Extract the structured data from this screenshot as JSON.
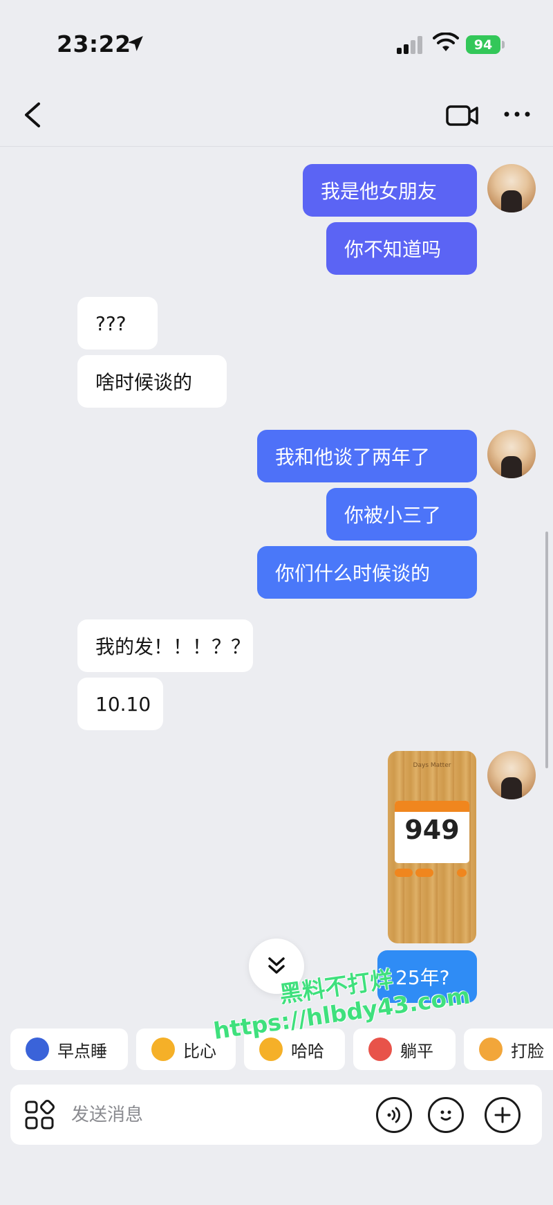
{
  "status_bar": {
    "time": "23:22",
    "battery": "94",
    "icons": [
      "location-arrow-icon",
      "signal-icon",
      "wifi-icon",
      "battery-icon"
    ]
  },
  "nav": {
    "icons": [
      "back-arrow-icon",
      "video-camera-icon",
      "more-dots-icon"
    ]
  },
  "messages": [
    {
      "side": "out",
      "text": "我是他女朋友",
      "color": "#5b64f4"
    },
    {
      "side": "out",
      "text": "你不知道吗",
      "color": "#5b64f4"
    },
    {
      "side": "in",
      "text": "???"
    },
    {
      "side": "in",
      "text": "啥时候谈的"
    },
    {
      "side": "out",
      "text": "我和他谈了两年了",
      "color": "#4e71f8"
    },
    {
      "side": "out",
      "text": "你被小三了",
      "color": "#4c74f9"
    },
    {
      "side": "out",
      "text": "你们什么时候谈的",
      "color": "#4a78f9"
    },
    {
      "side": "in",
      "text": "我的发！！！？？"
    },
    {
      "side": "in",
      "text": "10.10"
    },
    {
      "side": "out",
      "type": "image",
      "image": {
        "title": "Days Matter",
        "number": "949"
      }
    },
    {
      "side": "out",
      "text": "25年?",
      "color": "#2f8cf5"
    }
  ],
  "quick_replies": [
    {
      "label": "早点睡",
      "emoji_color": "#3a63d9"
    },
    {
      "label": "比心",
      "emoji_color": "#f5b028"
    },
    {
      "label": "哈哈",
      "emoji_color": "#f5b028"
    },
    {
      "label": "躺平",
      "emoji_color": "#e8534a"
    },
    {
      "label": "打脸",
      "emoji_color": "#f2a63a"
    }
  ],
  "watermark": {
    "line1": "黑料不打烊",
    "line2": "https://hlbdy43.com"
  },
  "input": {
    "placeholder": "发送消息",
    "icons": [
      "apps-grid-icon",
      "voice-icon",
      "emoji-icon",
      "plus-icon"
    ]
  },
  "colors": {
    "background": "#ecedf1",
    "incoming_bubble": "#ffffff",
    "watermark_green": "#3fe07d",
    "battery_green": "#33c759"
  }
}
